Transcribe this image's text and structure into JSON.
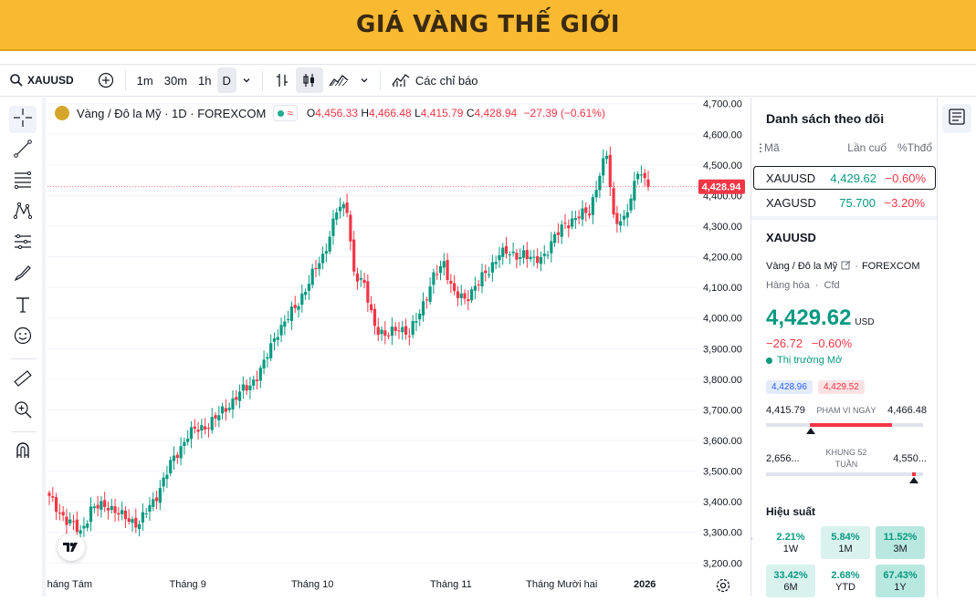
{
  "banner": {
    "title": "GIÁ VÀNG THẾ GIỚI"
  },
  "toolbar": {
    "symbol": "XAUUSD",
    "intervals": [
      "1m",
      "30m",
      "1h",
      "D"
    ],
    "indicators_label": "Các chỉ báo"
  },
  "legend": {
    "name": "Vàng / Đô la Mỹ · 1D · FOREXCOM",
    "o_key": "O",
    "o_val": "4,456.33",
    "h_key": "H",
    "h_val": "4,466.48",
    "l_key": "L",
    "l_val": "4,415.79",
    "c_key": "C",
    "c_val": "4,428.94",
    "change": "−27.39 (−0.61%)"
  },
  "price_tag": "4,428.94",
  "watchlist": {
    "title": "Danh sách theo dõi",
    "col_symbol": "Mã",
    "col_last": "Lần cuố",
    "col_change": "%Thđổ",
    "rows": [
      {
        "symbol": "XAUUSD",
        "last": "4,429.62",
        "change": "−0.60%"
      },
      {
        "symbol": "XAGUSD",
        "last": "75.700",
        "change": "−3.20%"
      }
    ]
  },
  "details": {
    "symbol": "XAUUSD",
    "name": "Vàng / Đô la Mỹ",
    "exchange": "FOREXCOM",
    "category": "Hàng hóa",
    "category_type": "Cfd",
    "price": "4,429.62",
    "currency": "USD",
    "change_abs": "−26.72",
    "change_pct": "−0.60%",
    "market_status": "Thị trường Mở",
    "bid": "4,428.96",
    "ask": "4,429.52",
    "day_low": "4,415.79",
    "day_label": "PHẠM VI NGÀY",
    "day_high": "4,466.48",
    "wk_low": "2,656...",
    "wk_label_1": "KHUNG 52",
    "wk_label_2": "TUẦN",
    "wk_high": "4,550...",
    "perf_title": "Hiệu suất",
    "perf": [
      {
        "value": "2.21%",
        "label": "1W"
      },
      {
        "value": "5.84%",
        "label": "1M"
      },
      {
        "value": "11.52%",
        "label": "3M"
      },
      {
        "value": "33.42%",
        "label": "6M"
      },
      {
        "value": "2.68%",
        "label": "YTD"
      },
      {
        "value": "67.43%",
        "label": "1Y"
      }
    ]
  },
  "colors": {
    "up": "#089981",
    "down": "#f23645",
    "banner": "#f9b930",
    "accent": "#2962ff"
  },
  "icons": [
    "search-icon",
    "add-symbol-icon",
    "chevron-down-icon",
    "bar-chart-icon",
    "candles-icon",
    "area-chart-icon",
    "indicators-icon",
    "crosshair-icon",
    "trend-line-icon",
    "fib-icon",
    "pattern-icon",
    "projection-icon",
    "brush-icon",
    "text-icon",
    "emoji-icon",
    "ruler-icon",
    "zoom-in-icon",
    "magnet-icon",
    "settings-icon",
    "tv-logo-icon",
    "notes-icon",
    "collapse-arrow-icon"
  ],
  "chart_data": {
    "type": "candlestick",
    "title": "",
    "xlabel": "",
    "ylabel": "",
    "ylim": [
      3180,
      4720
    ],
    "y_ticks": [
      "4,700.00",
      "4,600.00",
      "4,500.00",
      "4,400.00",
      "4,300.00",
      "4,200.00",
      "4,100.00",
      "4,000.00",
      "3,900.00",
      "3,800.00",
      "3,700.00",
      "3,600.00",
      "3,500.00",
      "3,400.00",
      "3,300.00",
      "3,200.00"
    ],
    "x_ticks": [
      "Tháng Tám",
      "Tháng 9",
      "Tháng 10",
      "Tháng 11",
      "Tháng Mười hai",
      "2026"
    ],
    "last_price": 4428.94,
    "waypoints": [
      [
        0,
        3410
      ],
      [
        5,
        3340
      ],
      [
        9,
        3300
      ],
      [
        12,
        3375
      ],
      [
        17,
        3390
      ],
      [
        21,
        3350
      ],
      [
        26,
        3330
      ],
      [
        30,
        3400
      ],
      [
        35,
        3520
      ],
      [
        40,
        3620
      ],
      [
        44,
        3640
      ],
      [
        49,
        3680
      ],
      [
        54,
        3745
      ],
      [
        58,
        3780
      ],
      [
        62,
        3850
      ],
      [
        66,
        3960
      ],
      [
        71,
        4030
      ],
      [
        75,
        4120
      ],
      [
        79,
        4200
      ],
      [
        83,
        4350
      ],
      [
        86,
        4360
      ],
      [
        88,
        4150
      ],
      [
        91,
        4100
      ],
      [
        94,
        3980
      ],
      [
        97,
        3935
      ],
      [
        101,
        3975
      ],
      [
        104,
        3940
      ],
      [
        108,
        4050
      ],
      [
        111,
        4130
      ],
      [
        114,
        4180
      ],
      [
        117,
        4080
      ],
      [
        120,
        4055
      ],
      [
        123,
        4110
      ],
      [
        127,
        4150
      ],
      [
        130,
        4220
      ],
      [
        134,
        4200
      ],
      [
        137,
        4215
      ],
      [
        140,
        4180
      ],
      [
        143,
        4210
      ],
      [
        146,
        4260
      ],
      [
        149,
        4310
      ],
      [
        153,
        4330
      ],
      [
        156,
        4350
      ],
      [
        159,
        4470
      ],
      [
        161,
        4530
      ],
      [
        163,
        4330
      ],
      [
        166,
        4320
      ],
      [
        168,
        4380
      ],
      [
        170,
        4490
      ],
      [
        172,
        4455
      ],
      [
        173,
        4429
      ]
    ]
  }
}
